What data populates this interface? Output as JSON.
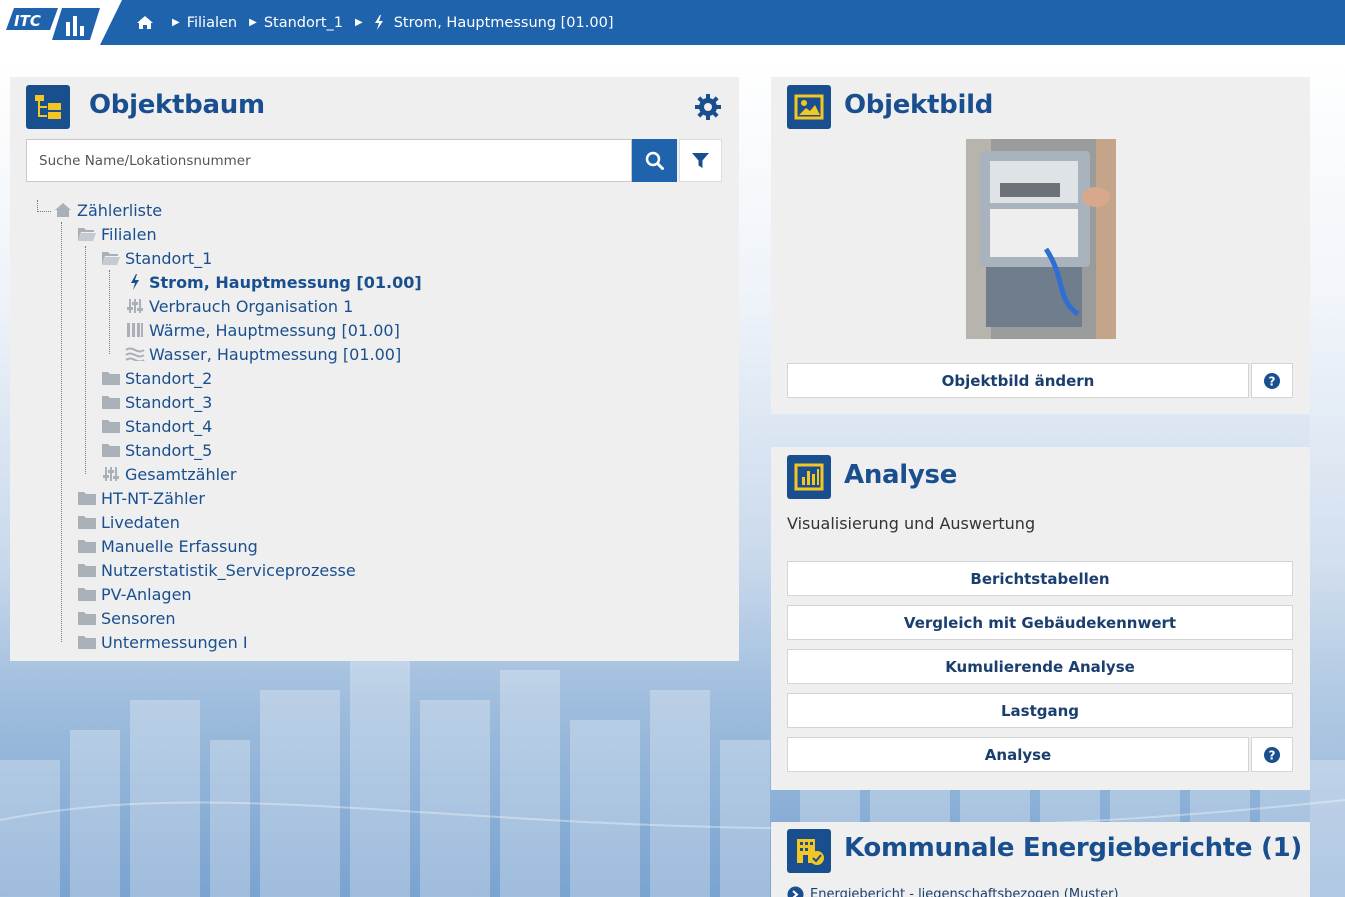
{
  "header": {
    "logo_text": "ITC",
    "breadcrumb": [
      "Filialen",
      "Standort_1",
      "Strom, Hauptmessung [01.00]"
    ],
    "icons": {
      "home": "home-icon",
      "separator": "caret-right-icon",
      "current": "lightning-icon"
    }
  },
  "objektbaum": {
    "title": "Objektbaum",
    "search_placeholder": "Suche Name/Lokationsnummer",
    "search_value": "",
    "icons": {
      "header": "tree-structure-icon",
      "settings": "gear-icon",
      "search": "search-icon",
      "filter": "filter-icon"
    },
    "tree": {
      "root": "Zählerliste",
      "filialen": "Filialen",
      "standort_1": "Standort_1",
      "standort_1_children": [
        "Strom, Hauptmessung [01.00]",
        "Verbrauch Organisation 1",
        "Wärme, Hauptmessung [01.00]",
        "Wasser, Hauptmessung [01.00]"
      ],
      "filialen_rest": [
        "Standort_2",
        "Standort_3",
        "Standort_4",
        "Standort_5",
        "Gesamtzähler"
      ],
      "top_level": [
        "HT-NT-Zähler",
        "Livedaten",
        "Manuelle Erfassung",
        "Nutzerstatistik_Serviceprozesse",
        "PV-Anlagen",
        "Sensoren",
        "Untermessungen I"
      ]
    }
  },
  "objektbild": {
    "title": "Objektbild",
    "change_button": "Objektbild ändern",
    "icons": {
      "header": "image-icon",
      "help": "question-circle-icon"
    }
  },
  "analyse": {
    "title": "Analyse",
    "subtitle": "Visualisierung und Auswertung",
    "buttons": [
      "Berichtstabellen",
      "Vergleich mit Gebäudekennwert",
      "Kumulierende Analyse",
      "Lastgang",
      "Analyse"
    ],
    "icons": {
      "header": "bar-chart-icon",
      "help": "question-circle-icon"
    }
  },
  "energieberichte": {
    "title": "Kommunale Energieberichte (1)",
    "first_item": "Energiebericht - liegenschaftsbezogen (Muster)",
    "icons": {
      "header": "building-check-icon",
      "item": "arrow-circle-icon"
    }
  },
  "colors": {
    "brand_blue": "#1f63ad",
    "dark_blue": "#1a4f8f",
    "panel_bg": "#efefef"
  }
}
